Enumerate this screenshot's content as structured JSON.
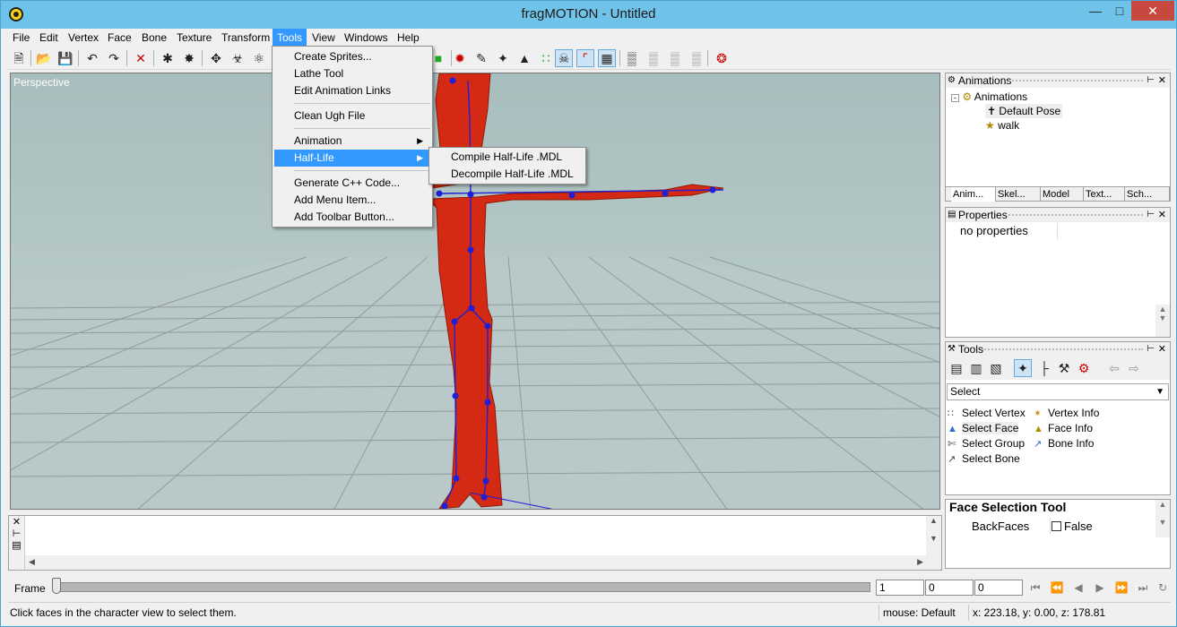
{
  "window": {
    "title": "fragMOTION - Untitled"
  },
  "menubar": [
    "File",
    "Edit",
    "Vertex",
    "Face",
    "Bone",
    "Texture",
    "Transform",
    "Tools",
    "View",
    "Windows",
    "Help"
  ],
  "tools_menu": {
    "items": [
      "Create Sprites...",
      "Lathe Tool",
      "Edit Animation Links",
      "Clean Ugh File",
      "Animation",
      "Half-Life",
      "Generate C++ Code...",
      "Add Menu Item...",
      "Add Toolbar Button..."
    ],
    "half_life_submenu": [
      "Compile Half-Life .MDL",
      "Decompile Half-Life .MDL"
    ]
  },
  "viewport": {
    "label": "Perspective"
  },
  "animations_panel": {
    "title": "Animations",
    "root": "Animations",
    "items": [
      "Default Pose",
      "walk"
    ],
    "tabs": [
      "Anim...",
      "Skel...",
      "Model",
      "Text...",
      "Sch..."
    ]
  },
  "properties_panel": {
    "title": "Properties",
    "empty_text": "no properties"
  },
  "tools_panel": {
    "title": "Tools",
    "mode": "Select",
    "left_items": [
      "Select Vertex",
      "Select Face",
      "Select Group",
      "Select Bone"
    ],
    "right_items": [
      "Vertex Info",
      "Face Info",
      "Bone Info"
    ]
  },
  "face_tool": {
    "title": "Face Selection Tool",
    "rows": [
      {
        "name": "BackFaces",
        "value": "False"
      }
    ]
  },
  "framebar": {
    "label": "Frame",
    "fields": [
      "1",
      "0",
      "0"
    ]
  },
  "statusbar": {
    "message": "Click faces in the character view to select them.",
    "mouse": "mouse: Default",
    "coords": "x: 223.18, y: 0.00, z: 178.81"
  },
  "colors": {
    "titlebar": "#6fc2e8",
    "highlight": "#3399ff",
    "model": "#d42a14",
    "bones": "#1f1fd6",
    "close": "#c7483f"
  },
  "icons": [
    "new-file-icon",
    "open-folder-icon",
    "save-icon",
    "undo-icon",
    "redo-icon",
    "delete-icon",
    "play-icon",
    "stop-icon",
    "rewind-icon",
    "fast-forward-icon"
  ]
}
